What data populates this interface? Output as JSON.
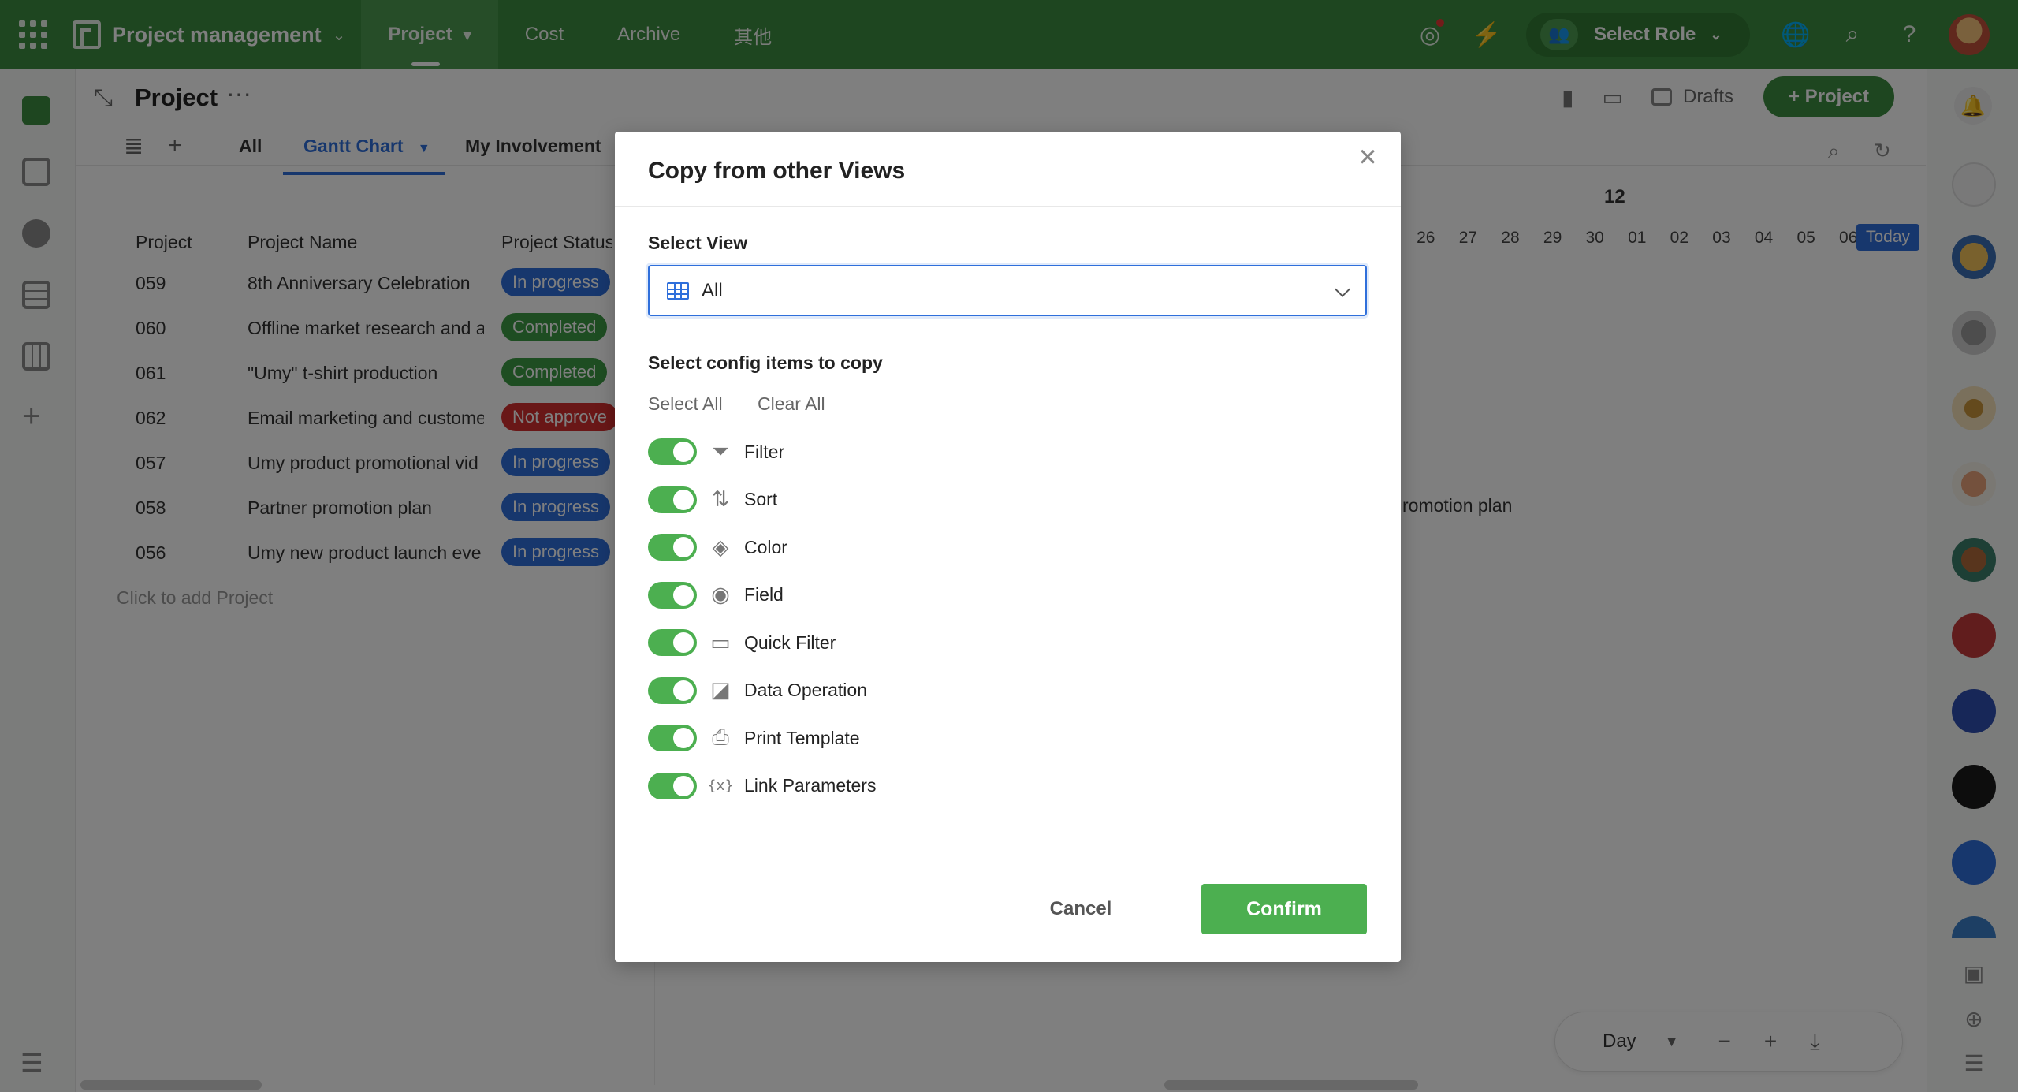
{
  "topbar": {
    "app_title": "Project management",
    "tabs": [
      "Project",
      "Cost",
      "Archive",
      "其他"
    ],
    "active_tab": "Project",
    "role_label": "Select Role"
  },
  "main": {
    "title": "Project",
    "drafts_label": "Drafts",
    "add_project_label": "+ Project",
    "view_tabs": [
      "All",
      "Gantt Chart",
      "My Involvement"
    ],
    "active_view_tab": "Gantt Chart",
    "columns": [
      "Project",
      "Project Name",
      "Project Status"
    ],
    "rows": [
      {
        "id": "059",
        "name": "8th Anniversary Celebration",
        "status": "In progress",
        "status_type": "progress"
      },
      {
        "id": "060",
        "name": "Offline market research and a",
        "status": "Completed",
        "status_type": "completed"
      },
      {
        "id": "061",
        "name": "\"Umy\" t-shirt production",
        "status": "Completed",
        "status_type": "completed"
      },
      {
        "id": "062",
        "name": "Email marketing and custome",
        "status": "Not approve",
        "status_type": "notapproved"
      },
      {
        "id": "057",
        "name": "Umy product promotional vid",
        "status": "In progress",
        "status_type": "progress"
      },
      {
        "id": "058",
        "name": "Partner promotion plan",
        "status": "In progress",
        "status_type": "progress"
      },
      {
        "id": "056",
        "name": "Umy new product launch eve",
        "status": "In progress",
        "status_type": "progress"
      }
    ],
    "add_row_label": "Click to add Project",
    "gantt": {
      "month": "12",
      "days": [
        "26",
        "27",
        "28",
        "29",
        "30",
        "01",
        "02",
        "03",
        "04",
        "05",
        "06"
      ],
      "today_label": "Today",
      "bar_label": "romotion plan"
    },
    "zoom": {
      "unit": "Day"
    }
  },
  "modal": {
    "title": "Copy from other Views",
    "select_view_label": "Select View",
    "select_view_value": "All",
    "config_label": "Select config items to copy",
    "select_all_label": "Select All",
    "clear_all_label": "Clear All",
    "items": [
      {
        "label": "Filter",
        "icon": "filter-icon",
        "enabled": true
      },
      {
        "label": "Sort",
        "icon": "sort-icon",
        "enabled": true
      },
      {
        "label": "Color",
        "icon": "paint-bucket-icon",
        "enabled": true
      },
      {
        "label": "Field",
        "icon": "eye-icon",
        "enabled": true
      },
      {
        "label": "Quick Filter",
        "icon": "quick-filter-icon",
        "enabled": true
      },
      {
        "label": "Data Operation",
        "icon": "data-operation-icon",
        "enabled": true
      },
      {
        "label": "Print Template",
        "icon": "printer-icon",
        "enabled": true
      },
      {
        "label": "Link Parameters",
        "icon": "link-parameters-icon",
        "enabled": true
      }
    ],
    "cancel_label": "Cancel",
    "confirm_label": "Confirm"
  },
  "colors": {
    "brand_green": "#3d8c40",
    "accent_blue": "#2f6fdb",
    "toggle_green": "#4caf50",
    "error_red": "#d32f2f"
  }
}
